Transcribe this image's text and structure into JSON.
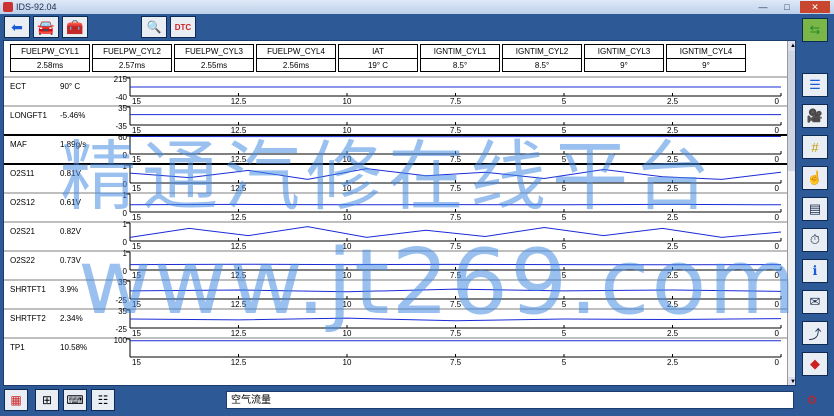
{
  "window": {
    "title": "IDS-92.04",
    "minimize": "—",
    "maximize": "□",
    "close": "✕"
  },
  "toolbar": {
    "back_icon": "back-arrow-icon",
    "vehicle_icon": "car-icon",
    "toolbox_icon": "toolbox-icon",
    "datalogger_icon": "datalogger-icon",
    "dtc_label": "DTC"
  },
  "header": [
    {
      "name": "FUELPW_CYL1",
      "value": "2.58ms"
    },
    {
      "name": "FUELPW_CYL2",
      "value": "2.57ms"
    },
    {
      "name": "FUELPW_CYL3",
      "value": "2.55ms"
    },
    {
      "name": "FUELPW_CYL4",
      "value": "2.56ms"
    },
    {
      "name": "IAT",
      "value": "19° C"
    },
    {
      "name": "IGNTIM_CYL1",
      "value": "8.5°"
    },
    {
      "name": "IGNTIM_CYL2",
      "value": "8.5°"
    },
    {
      "name": "IGNTIM_CYL3",
      "value": "9°"
    },
    {
      "name": "IGNTIM_CYL4",
      "value": "9°"
    }
  ],
  "rows": [
    {
      "label": "ECT",
      "value": "90° C",
      "ytop": "215",
      "ybot": "-40",
      "wave": [
        0.5,
        0.5,
        0.5
      ]
    },
    {
      "label": "LONGFT1",
      "value": "-5.46%",
      "ytop": "35",
      "ybot": "-35",
      "wave": [
        0.58,
        0.58,
        0.58
      ]
    },
    {
      "label": "MAF",
      "value": "1.89g/s",
      "ytop": "60",
      "ybot": "0",
      "wave": [
        0.97,
        0.96,
        0.97
      ]
    },
    {
      "label": "O2S11",
      "value": "0.81V",
      "ytop": "1",
      "ybot": "0",
      "wave": [
        0.55,
        0.3,
        0.7,
        0.2,
        0.8,
        0.4,
        0.6,
        0.25,
        0.75,
        0.35,
        0.2,
        0.6
      ]
    },
    {
      "label": "O2S12",
      "value": "0.61V",
      "ytop": "1",
      "ybot": "0",
      "wave": [
        0.4,
        0.42,
        0.4,
        0.41,
        0.4,
        0.42,
        0.4
      ]
    },
    {
      "label": "O2S21",
      "value": "0.82V",
      "ytop": "1",
      "ybot": "0",
      "wave": [
        0.2,
        0.7,
        0.3,
        0.8,
        0.2,
        0.6,
        0.25,
        0.75,
        0.3,
        0.7,
        0.2,
        0.5
      ]
    },
    {
      "label": "O2S22",
      "value": "0.73V",
      "ytop": "1",
      "ybot": "0",
      "wave": [
        0.3,
        0.32,
        0.3,
        0.31,
        0.3,
        0.29,
        0.3
      ]
    },
    {
      "label": "SHRTFT1",
      "value": "3.9%",
      "ytop": "35",
      "ybot": "-25",
      "wave": [
        0.45,
        0.5,
        0.4,
        0.55,
        0.45,
        0.5,
        0.42
      ]
    },
    {
      "label": "SHRTFT2",
      "value": "2.34%",
      "ytop": "35",
      "ybot": "-25",
      "wave": [
        0.5,
        0.45,
        0.55,
        0.4,
        0.5,
        0.47,
        0.52
      ]
    },
    {
      "label": "TP1",
      "value": "10.58%",
      "ytop": "100",
      "ybot": "",
      "wave": [
        0.9,
        0.9,
        0.9
      ]
    }
  ],
  "xticks": [
    "15",
    "12.5",
    "10",
    "7.5",
    "5",
    "2.5",
    "0"
  ],
  "colors": {
    "trace": "#1a2bd6",
    "panel_bg": "#ffffff",
    "frame": "#2d5a96"
  },
  "sidebar": [
    "swap-arrows-icon",
    "list-icon",
    "camera-icon",
    "hash-icon",
    "hand-pointer-icon",
    "table-icon",
    "stopwatch-icon",
    "info-icon",
    "graph-mail-icon",
    "graph-export-icon",
    "palette-icon"
  ],
  "bottombar": {
    "status_text": "空气流量",
    "buttons": [
      "selector-icon",
      "grid-icon",
      "keyboard-icon",
      "list-grid-icon"
    ],
    "right_icon": "connector-icon"
  },
  "watermark": {
    "line1": "精通汽修在线平台",
    "line2": "www.jt269.com"
  }
}
